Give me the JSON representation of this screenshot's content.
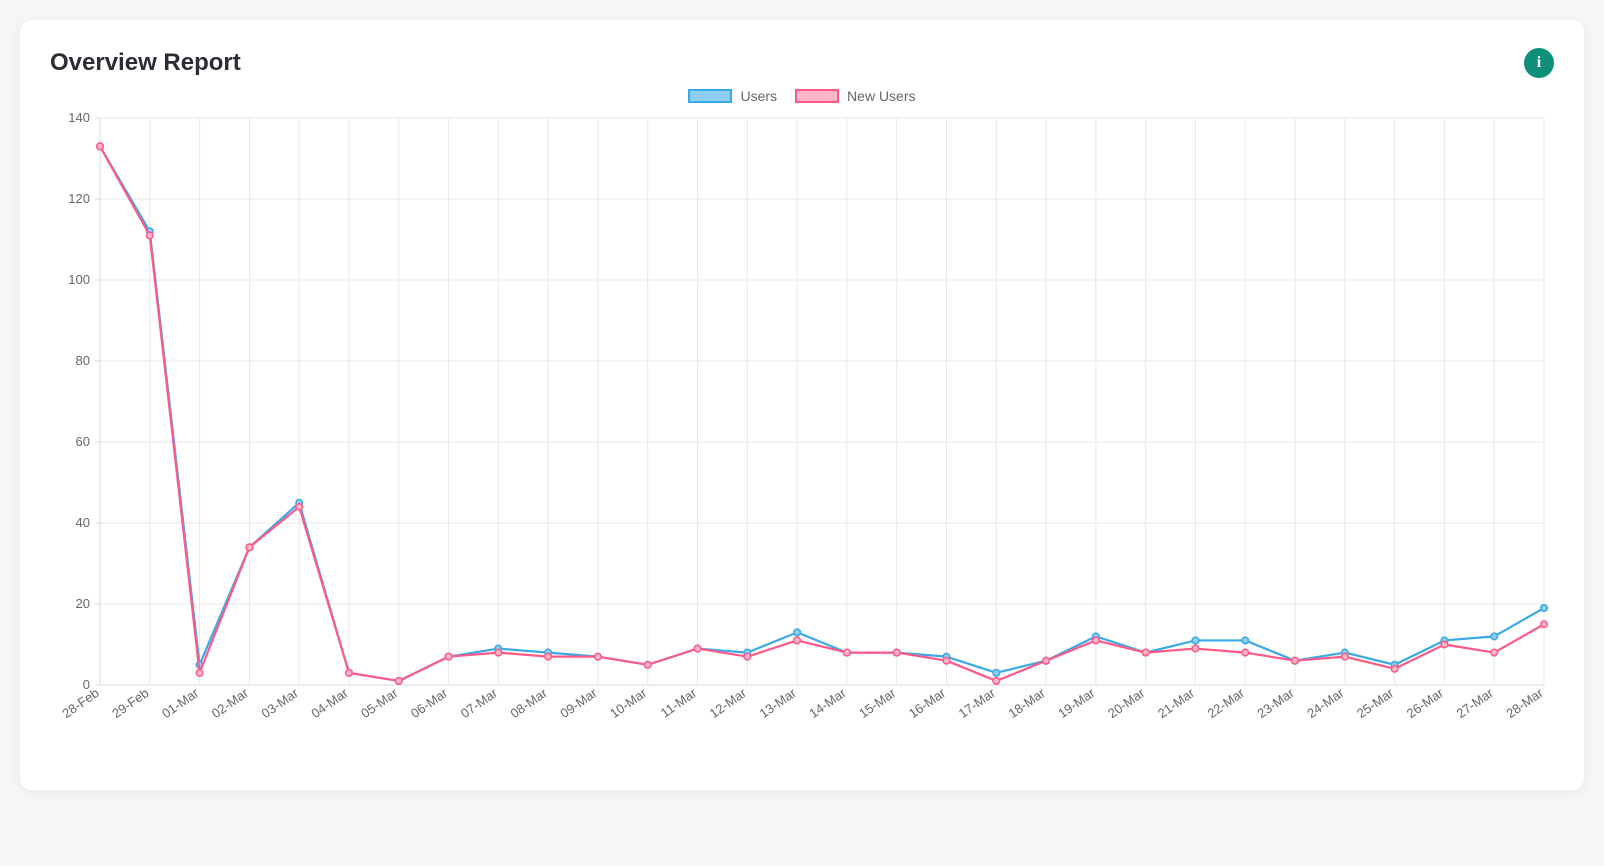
{
  "header": {
    "title": "Overview Report",
    "info_icon_label": "i"
  },
  "legend": {
    "items": [
      {
        "name": "Users",
        "stroke": "#3aa9e8",
        "fill": "#8ecdf2"
      },
      {
        "name": "New Users",
        "stroke": "#ff5a87",
        "fill": "#ffb6c9"
      }
    ]
  },
  "chart_data": {
    "type": "line",
    "title": "Overview Report",
    "xlabel": "",
    "ylabel": "",
    "ylim": [
      0,
      140
    ],
    "yticks": [
      0,
      20,
      40,
      60,
      80,
      100,
      120,
      140
    ],
    "categories": [
      "28-Feb",
      "29-Feb",
      "01-Mar",
      "02-Mar",
      "03-Mar",
      "04-Mar",
      "05-Mar",
      "06-Mar",
      "07-Mar",
      "08-Mar",
      "09-Mar",
      "10-Mar",
      "11-Mar",
      "12-Mar",
      "13-Mar",
      "14-Mar",
      "15-Mar",
      "16-Mar",
      "17-Mar",
      "18-Mar",
      "19-Mar",
      "20-Mar",
      "21-Mar",
      "22-Mar",
      "23-Mar",
      "24-Mar",
      "25-Mar",
      "26-Mar",
      "27-Mar",
      "28-Mar"
    ],
    "series": [
      {
        "name": "Users",
        "color": "#3aa9e8",
        "point_fill": "#8ecdf2",
        "values": [
          133,
          112,
          5,
          34,
          45,
          3,
          1,
          7,
          9,
          8,
          7,
          5,
          9,
          8,
          13,
          8,
          8,
          7,
          3,
          6,
          12,
          8,
          11,
          11,
          6,
          8,
          5,
          11,
          12,
          19
        ]
      },
      {
        "name": "New Users",
        "color": "#ff5a87",
        "point_fill": "#ffb6c9",
        "values": [
          133,
          111,
          3,
          34,
          44,
          3,
          1,
          7,
          8,
          7,
          7,
          5,
          9,
          7,
          11,
          8,
          8,
          6,
          1,
          6,
          11,
          8,
          9,
          8,
          6,
          7,
          4,
          10,
          8,
          15
        ]
      }
    ],
    "grid": true,
    "legend_position": "top"
  }
}
